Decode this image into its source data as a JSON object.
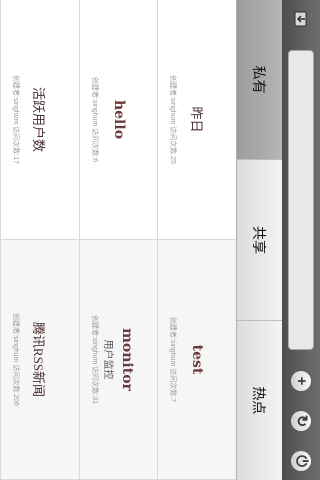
{
  "toolbar": {
    "search_value": "",
    "search_placeholder": "",
    "icons": [
      "home-icon",
      "add-icon",
      "refresh-icon",
      "power-icon"
    ]
  },
  "tabs": [
    {
      "label": "私有"
    },
    {
      "label": "共享"
    },
    {
      "label": "热点"
    }
  ],
  "cells": [
    {
      "title": "昨日",
      "subtitle": "",
      "meta": "创建者:singhum  访问次数:25"
    },
    {
      "title": "test",
      "subtitle": "",
      "meta": "创建者:singhum  访问次数:7"
    },
    {
      "title": "hello",
      "subtitle": "",
      "meta": "创建者:singhum  访问次数:6"
    },
    {
      "title": "monitor",
      "subtitle": "用户监控",
      "meta": "创建者:singhum  访问次数:31"
    },
    {
      "title": "活跃用户数",
      "subtitle": "",
      "meta": "创建者:singhum  访问次数:17"
    },
    {
      "title": "腾讯RSS新闻",
      "subtitle": "",
      "meta": "创建者:singhum  访问次数:206"
    }
  ]
}
